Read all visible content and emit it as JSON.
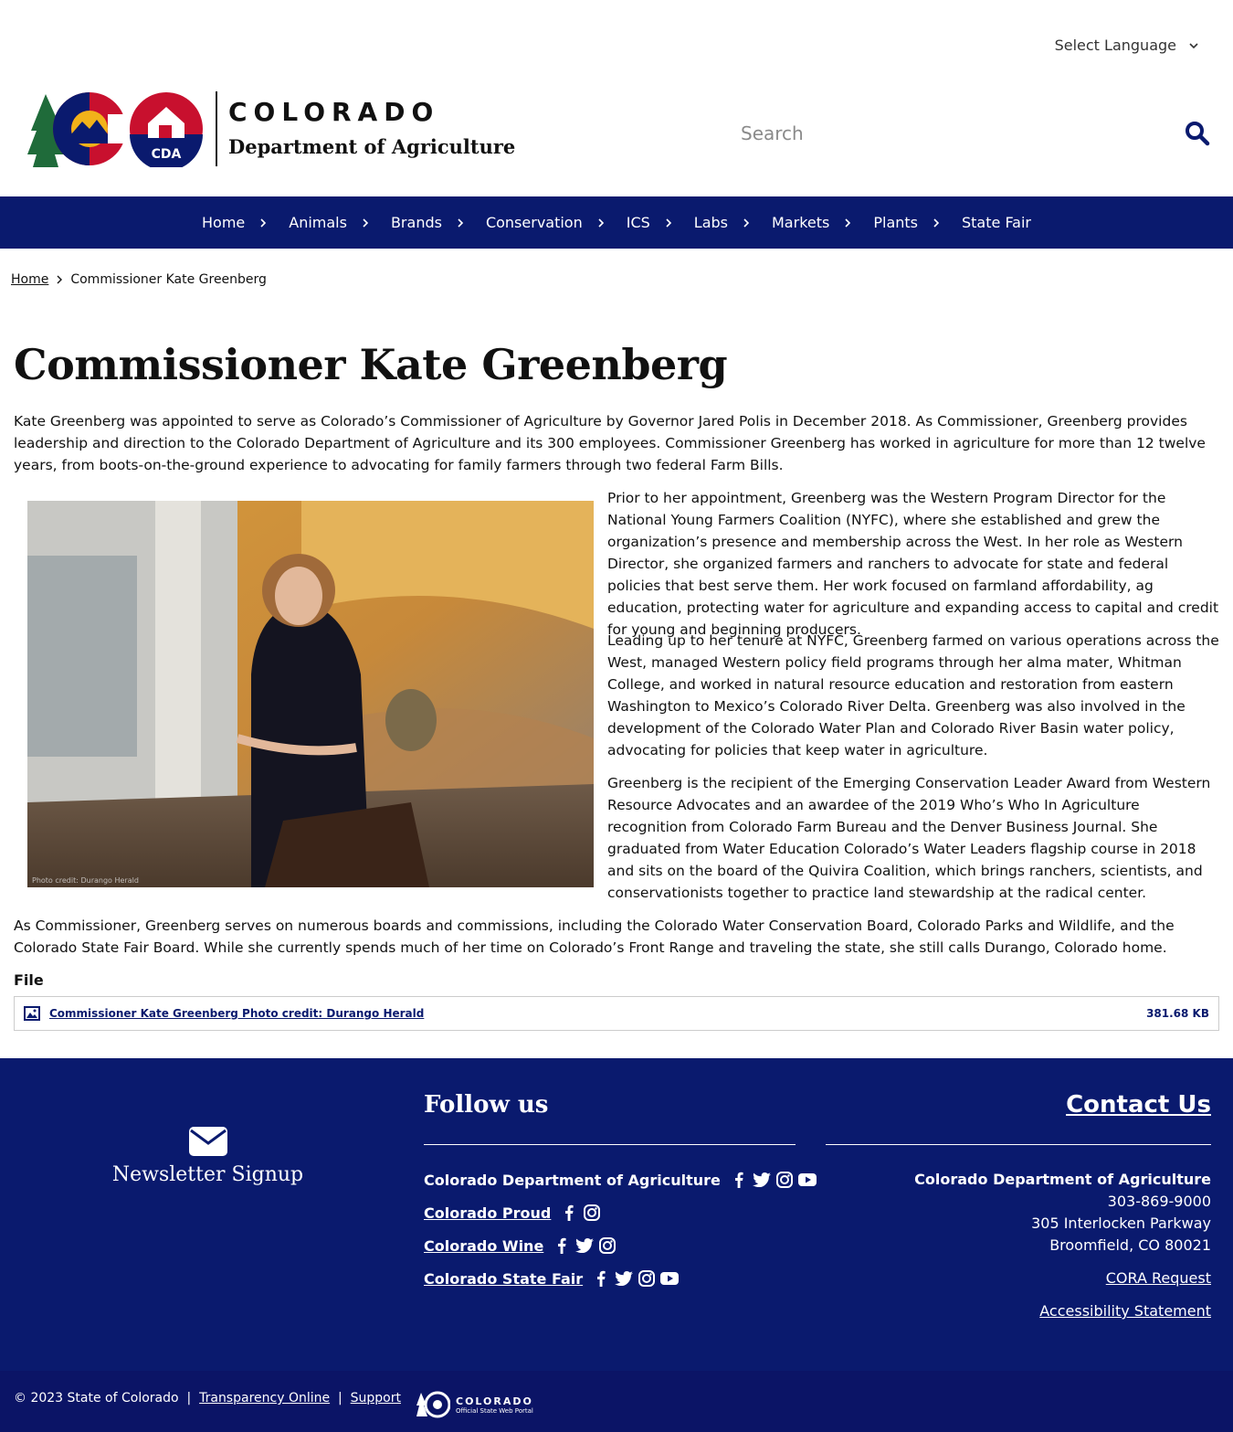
{
  "language": {
    "label": "Select Language"
  },
  "header": {
    "state_name": "COLORADO",
    "dept_name": "Department of Agriculture",
    "badge_text": "CDA",
    "search_placeholder": "Search"
  },
  "nav": {
    "items": [
      {
        "label": "Home"
      },
      {
        "label": "Animals"
      },
      {
        "label": "Brands"
      },
      {
        "label": "Conservation"
      },
      {
        "label": "ICS"
      },
      {
        "label": "Labs"
      },
      {
        "label": "Markets"
      },
      {
        "label": "Plants"
      },
      {
        "label": "State Fair"
      }
    ]
  },
  "breadcrumb": {
    "home": "Home",
    "current": "Commissioner Kate Greenberg"
  },
  "main": {
    "title": "Commissioner Kate Greenberg",
    "intro": "Kate Greenberg was appointed to serve as Colorado’s Commissioner of Agriculture by Governor Jared Polis in December 2018. As Commissioner, Greenberg provides leadership and direction to the Colorado Department of Agriculture and its 300 employees. Commissioner Greenberg has worked in agriculture for more than 12 twelve years, from boots-on-the-ground experience to advocating for family farmers through two federal Farm Bills.",
    "photo_credit": "Photo credit: Durango Herald",
    "p1": "Prior to her appointment, Greenberg was the Western Program Director for the National Young Farmers Coalition (NYFC), where she established and grew the organization’s presence and membership across the West. In her role as Western Director, she organized farmers and ranchers to advocate for state and federal policies that best serve them. Her work focused on farmland affordability, ag education, protecting water for agriculture and expanding access to capital and credit for young and beginning producers.",
    "p2": "Leading up to her tenure at NYFC, Greenberg farmed on various operations across the West, managed Western policy field programs through her alma mater, Whitman College, and worked in natural resource education and restoration from eastern Washington to Mexico’s Colorado River Delta. Greenberg was also involved in the development of the Colorado Water Plan and Colorado River Basin water policy, advocating for policies that keep water in agriculture.",
    "p3": "Greenberg is the recipient of the Emerging Conservation Leader Award from Western Resource Advocates and an awardee of the 2019 Who’s Who In Agriculture recognition from Colorado Farm Bureau and the Denver Business Journal. She graduated from Water Education Colorado’s Water Leaders flagship course in 2018 and sits on the board of the Quivira Coalition, which brings ranchers, scientists, and conservationists together to practice land stewardship at the radical center.",
    "outro": "As Commissioner, Greenberg serves on numerous boards and commissions, including the Colorado Water Conservation Board, Colorado Parks and Wildlife, and the Colorado State Fair Board. While she currently spends much of her time on Colorado’s Front Range and traveling the state, she still calls Durango, Colorado home.",
    "file_label": "File",
    "file_name": "Commissioner Kate Greenberg Photo credit: Durango Herald",
    "file_size": "381.68 KB"
  },
  "footer": {
    "newsletter": "Newsletter Signup",
    "follow_title": "Follow us",
    "social": [
      {
        "name": "Colorado Department of Agriculture",
        "icons": [
          "facebook-icon",
          "twitter-icon",
          "instagram-icon",
          "youtube-icon"
        ]
      },
      {
        "name": "Colorado Proud",
        "icons": [
          "facebook-icon",
          "instagram-icon"
        ]
      },
      {
        "name": "Colorado Wine",
        "icons": [
          "facebook-icon",
          "twitter-icon",
          "instagram-icon"
        ]
      },
      {
        "name": "Colorado State Fair",
        "icons": [
          "facebook-icon",
          "twitter-icon",
          "instagram-icon",
          "youtube-icon"
        ]
      }
    ],
    "contact_title": "Contact Us",
    "org": "Colorado Department of Agriculture",
    "phone": "303-869-9000",
    "address1": "305 Interlocken Parkway",
    "address2": "Broomfield, CO 80021",
    "cora": "CORA Request",
    "accessibility": "Accessibility Statement",
    "copyright": "© 2023 State of Colorado",
    "separator": "|",
    "transparency": "Transparency Online",
    "support": "Support",
    "portal_name": "COLORADO",
    "portal_sub": "Official State Web Portal"
  },
  "colors": {
    "brand_navy": "#0a1a6e",
    "logo_red": "#c8102e",
    "logo_gold": "#f2b21a"
  }
}
